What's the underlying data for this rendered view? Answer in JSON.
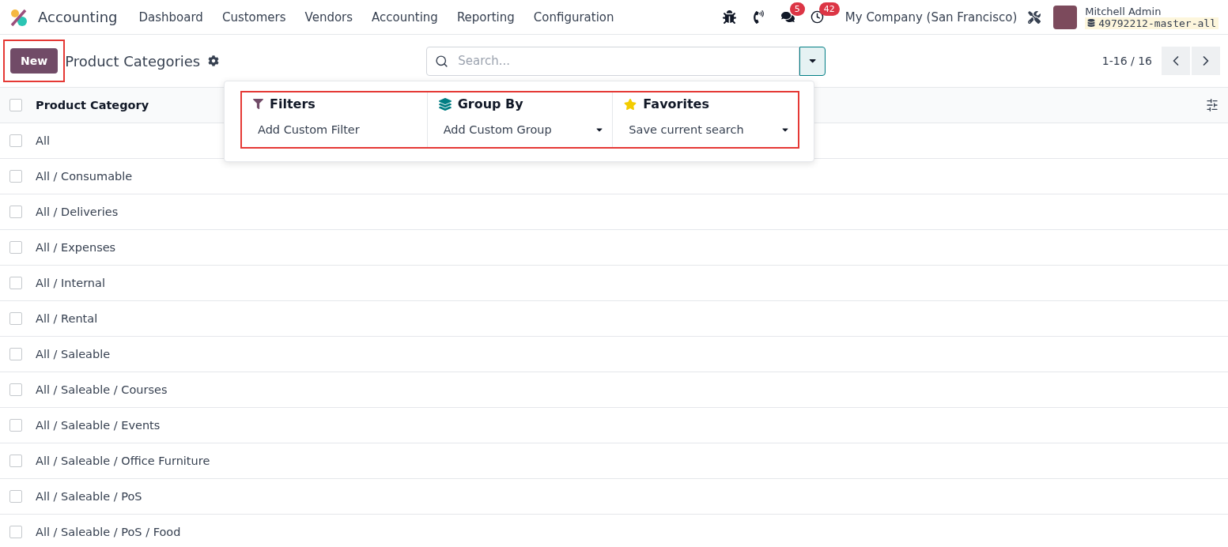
{
  "navbar": {
    "app_name": "Accounting",
    "menu": [
      "Dashboard",
      "Customers",
      "Vendors",
      "Accounting",
      "Reporting",
      "Configuration"
    ],
    "systray": [
      {
        "kind": "bug"
      },
      {
        "kind": "phone"
      },
      {
        "kind": "chat",
        "badge": "5"
      },
      {
        "kind": "clock",
        "badge": "42"
      }
    ],
    "company": "My Company (San Francisco)",
    "user": {
      "name": "Mitchell Admin",
      "database": "49792212-master-all"
    }
  },
  "control_panel": {
    "new_button": "New",
    "title": "Product Categories",
    "search": {
      "placeholder": "Search..."
    },
    "pager": "1-16 / 16"
  },
  "search_panel": {
    "sections": [
      {
        "kind": "filters",
        "title": "Filters",
        "action": "Add Custom Filter",
        "has_caret": false
      },
      {
        "kind": "group",
        "title": "Group By",
        "action": "Add Custom Group",
        "has_caret": true
      },
      {
        "kind": "favorites",
        "title": "Favorites",
        "action": "Save current search",
        "has_caret": true
      }
    ]
  },
  "table": {
    "column": "Product Category",
    "select_all": {
      "checked": false
    },
    "rows": [
      {
        "name": "All",
        "checked": false
      },
      {
        "name": "All / Consumable",
        "checked": false
      },
      {
        "name": "All / Deliveries",
        "checked": false
      },
      {
        "name": "All / Expenses",
        "checked": false
      },
      {
        "name": "All / Internal",
        "checked": false
      },
      {
        "name": "All / Rental",
        "checked": false
      },
      {
        "name": "All / Saleable",
        "checked": false
      },
      {
        "name": "All / Saleable / Courses",
        "checked": false
      },
      {
        "name": "All / Saleable / Events",
        "checked": false
      },
      {
        "name": "All / Saleable / Office Furniture",
        "checked": false
      },
      {
        "name": "All / Saleable / PoS",
        "checked": false
      },
      {
        "name": "All / Saleable / PoS / Food",
        "checked": false
      }
    ]
  }
}
